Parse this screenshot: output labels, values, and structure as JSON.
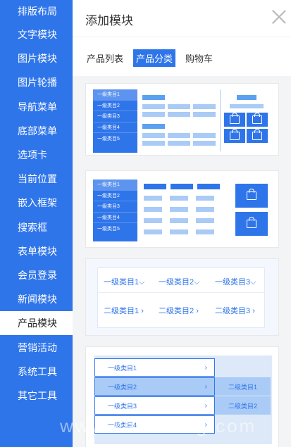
{
  "sidebar": {
    "items": [
      {
        "label": "排版布局"
      },
      {
        "label": "文字模块"
      },
      {
        "label": "图片模块"
      },
      {
        "label": "图片轮播"
      },
      {
        "label": "导航菜单"
      },
      {
        "label": "底部菜单"
      },
      {
        "label": "选项卡"
      },
      {
        "label": "当前位置"
      },
      {
        "label": "嵌入框架"
      },
      {
        "label": "搜索框"
      },
      {
        "label": "表单模块"
      },
      {
        "label": "会员登录"
      },
      {
        "label": "新闻模块"
      },
      {
        "label": "产品模块",
        "active": true
      },
      {
        "label": "营销活动"
      },
      {
        "label": "系统工具"
      },
      {
        "label": "其它工具"
      }
    ]
  },
  "panel": {
    "title": "添加模块",
    "tabs": [
      {
        "label": "产品列表"
      },
      {
        "label": "产品分类",
        "active": true
      },
      {
        "label": "购物车"
      }
    ]
  },
  "module1": {
    "nav": [
      "一级类目1",
      "一级类目2",
      "一级类目3",
      "一级类目4",
      "一级类目5"
    ]
  },
  "module2": {
    "nav": [
      "一级类目1",
      "一级类目2",
      "一级类目3",
      "一级类目4",
      "一级类目5"
    ]
  },
  "module3": {
    "top": [
      "一级类目1",
      "一级类目2",
      "一级类目3"
    ],
    "bottom": [
      "二级类目1",
      "二级类目2",
      "二级类目3"
    ],
    "top_arrow": "⌵",
    "bottom_arrow": "›"
  },
  "module4": {
    "rows": [
      "一级类目1",
      "一级类目2",
      "一级类目3",
      "一级类目4"
    ],
    "sub": [
      "二级类目1",
      "二级类目2"
    ],
    "arrow": "›"
  },
  "watermark": "www.xuesheng.com",
  "colors": {
    "accent": "#2f75ea",
    "light": "#a9cbf6",
    "mid": "#5ba1ef"
  },
  "icons": {
    "close": "close-icon",
    "bag": "shopping-bag-icon"
  }
}
